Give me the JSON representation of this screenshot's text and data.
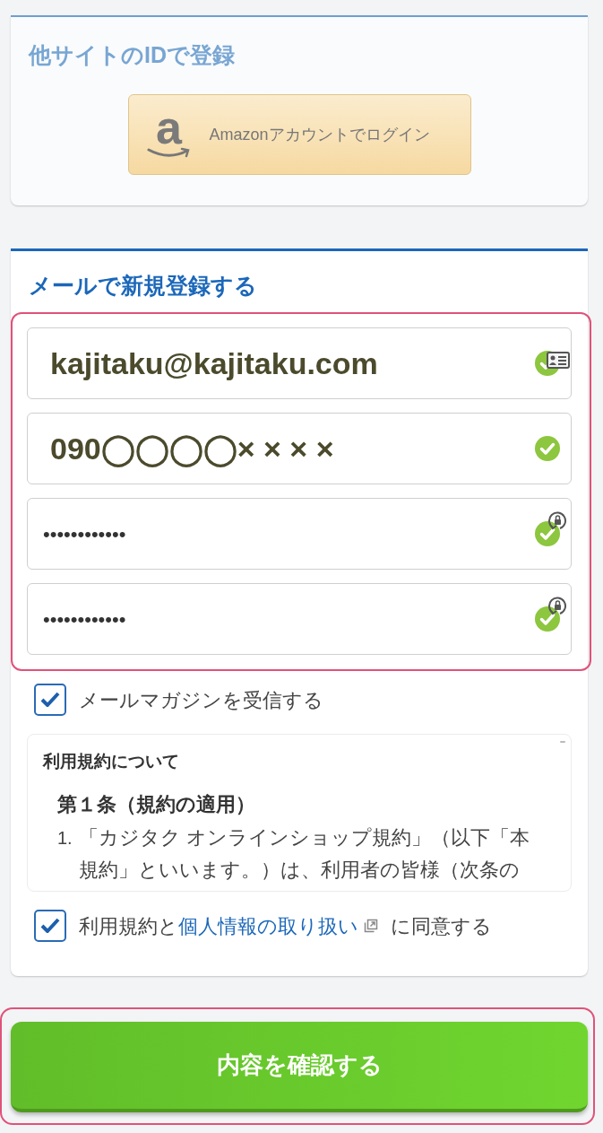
{
  "other_site": {
    "title": "他サイトのIDで登録",
    "amazon_button": {
      "logo_letter": "a",
      "label": "Amazonアカウントでログイン"
    }
  },
  "email_signup": {
    "title": "メールで新規登録する",
    "fields": [
      {
        "kind": "email",
        "value": "kajitaku@kajitaku.com",
        "valid": true
      },
      {
        "kind": "tel",
        "value": "090◯◯◯◯× × × ×",
        "valid": true
      },
      {
        "kind": "password",
        "value": "••••••••••••",
        "valid": true
      },
      {
        "kind": "password",
        "value": "••••••••••••",
        "valid": true
      }
    ],
    "newsletter": {
      "label": "メールマガジンを受信する",
      "checked": true
    },
    "terms": {
      "title": "利用規約について",
      "article": "第１条（規約の適用）",
      "items": [
        {
          "number": "1.",
          "lines": [
            "「カジタク オンラインショップ規約」（以下「本",
            "規約」といいます。）は、利用者の皆様（次条の"
          ]
        }
      ]
    },
    "agree": {
      "checked": true,
      "before": "利用規約と",
      "link": "個人情報の取り扱い",
      "after": "に同意する"
    }
  },
  "submit_button": {
    "label": "内容を確認する"
  }
}
